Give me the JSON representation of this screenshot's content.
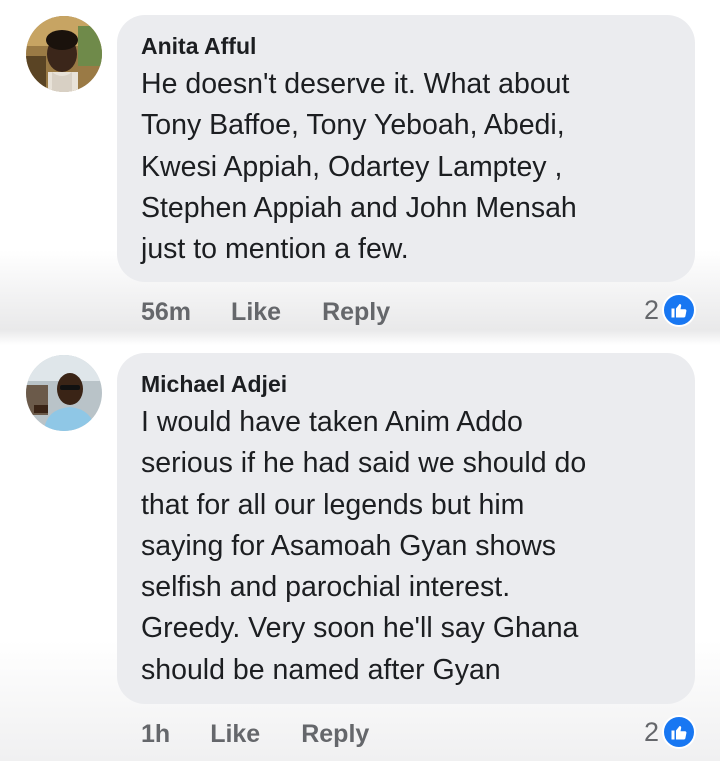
{
  "comments": [
    {
      "author": "Anita Afful",
      "text": "He doesn't deserve it. What about\nTony Baffoe, Tony Yeboah, Abedi,\nKwesi Appiah, Odartey Lamptey ,\nStephen Appiah and John Mensah\njust to mention a few.",
      "time": "56m",
      "like_label": "Like",
      "reply_label": "Reply",
      "reaction_count": "2",
      "reaction_icon": "thumbs-up-icon"
    },
    {
      "author": "Michael Adjei",
      "text": "I would have taken Anim Addo\nserious if he had said we should do\nthat for all our legends but him\nsaying for Asamoah Gyan shows\nselfish and parochial interest.\nGreedy. Very soon he'll say Ghana\nshould be named after Gyan",
      "time": "1h",
      "like_label": "Like",
      "reply_label": "Reply",
      "reaction_count": "2",
      "reaction_icon": "thumbs-up-icon"
    }
  ],
  "colors": {
    "bubble": "#ebecef",
    "text": "#1c1e21",
    "meta": "#65676b",
    "like_blue": "#1877f2"
  }
}
